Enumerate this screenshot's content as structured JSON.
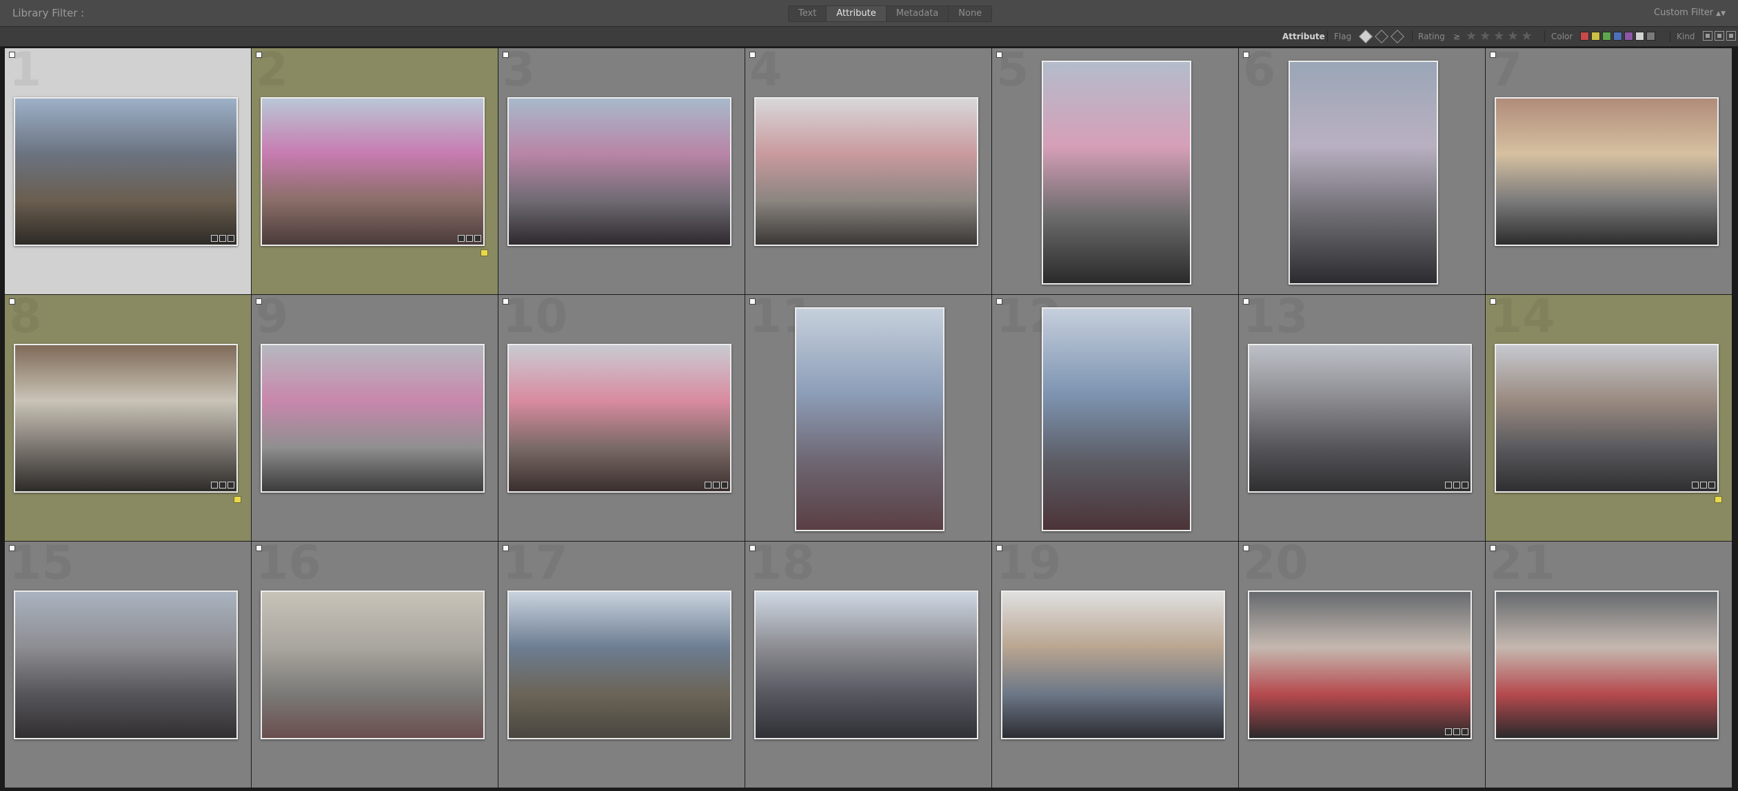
{
  "filter_bar": {
    "title": "Library Filter :",
    "tabs": [
      "Text",
      "Attribute",
      "Metadata",
      "None"
    ],
    "active_tab": "Attribute",
    "custom_filter": "Custom Filter"
  },
  "attribute_bar": {
    "attribute_label": "Attribute",
    "flag_label": "Flag",
    "rating_label": "Rating",
    "rating_operator": "≥",
    "stars": "★★★★★",
    "color_label": "Color",
    "colors": [
      "#c94a4a",
      "#cbbf45",
      "#5ea64d",
      "#4d71b8",
      "#8c57a7",
      "#d2d2d2",
      "#7a7a7a"
    ],
    "kind_label": "Kind"
  },
  "grid": {
    "cells": [
      {
        "num": "1",
        "orient": "land",
        "state": "selected",
        "badges": true,
        "tag": false,
        "colors": [
          "#9db1c8",
          "#6b7380",
          "#6a5e4f",
          "#2d2a26"
        ]
      },
      {
        "num": "2",
        "orient": "land",
        "state": "tinted",
        "badges": true,
        "tag": true,
        "colors": [
          "#b9c7d6",
          "#c77bb0",
          "#8a6e68",
          "#4a3b3a"
        ]
      },
      {
        "num": "3",
        "orient": "land",
        "state": "normal",
        "badges": false,
        "tag": false,
        "colors": [
          "#a8b9cc",
          "#b885a6",
          "#6f6a73",
          "#2e2a2e"
        ]
      },
      {
        "num": "4",
        "orient": "land",
        "state": "normal",
        "badges": false,
        "tag": false,
        "colors": [
          "#d8d8da",
          "#c99a9e",
          "#8b8580",
          "#3a3836"
        ]
      },
      {
        "num": "5",
        "orient": "port",
        "state": "normal",
        "badges": false,
        "tag": false,
        "colors": [
          "#b3bccb",
          "#d69fb8",
          "#6b6b6b",
          "#2b2b2b"
        ]
      },
      {
        "num": "6",
        "orient": "port",
        "state": "normal",
        "badges": false,
        "tag": false,
        "colors": [
          "#9aa6b6",
          "#b9b0c2",
          "#6c6b70",
          "#2c2c30"
        ]
      },
      {
        "num": "7",
        "orient": "land",
        "state": "normal",
        "badges": false,
        "tag": false,
        "colors": [
          "#b08c7a",
          "#d6c0a0",
          "#7b7b7b",
          "#2d2d2d"
        ]
      },
      {
        "num": "8",
        "orient": "land",
        "state": "tinted",
        "badges": true,
        "tag": true,
        "colors": [
          "#7f6a58",
          "#c9c4b7",
          "#7b7570",
          "#2d2b28"
        ]
      },
      {
        "num": "9",
        "orient": "land",
        "state": "normal",
        "badges": false,
        "tag": false,
        "colors": [
          "#b6b8bf",
          "#c887ac",
          "#8f8f8f",
          "#3b3b3b"
        ]
      },
      {
        "num": "10",
        "orient": "land",
        "state": "normal",
        "badges": true,
        "tag": false,
        "colors": [
          "#c9cbd2",
          "#d98ba0",
          "#7a6a66",
          "#3a2f2e"
        ]
      },
      {
        "num": "11",
        "orient": "port",
        "state": "normal",
        "badges": false,
        "tag": false,
        "colors": [
          "#c6d0dc",
          "#8d9eb8",
          "#6d6570",
          "#5a3f44"
        ]
      },
      {
        "num": "12",
        "orient": "port",
        "state": "normal",
        "badges": false,
        "tag": false,
        "colors": [
          "#c6cfdc",
          "#7e95b2",
          "#5b5b63",
          "#4b3438"
        ]
      },
      {
        "num": "13",
        "orient": "land",
        "state": "normal",
        "badges": true,
        "tag": false,
        "colors": [
          "#bdc1c8",
          "#8a8a8e",
          "#56565a",
          "#2f2f31"
        ]
      },
      {
        "num": "14",
        "orient": "land",
        "state": "tinted",
        "badges": true,
        "tag": true,
        "colors": [
          "#c6c9cf",
          "#9a8a80",
          "#5a5a5e",
          "#2f2f31"
        ]
      },
      {
        "num": "15",
        "orient": "land",
        "state": "normal",
        "badges": false,
        "tag": false,
        "colors": [
          "#a9b3bf",
          "#8d8d92",
          "#56565a",
          "#322f31"
        ]
      },
      {
        "num": "16",
        "orient": "land",
        "state": "normal",
        "badges": false,
        "tag": false,
        "colors": [
          "#c8c3b8",
          "#a9a59f",
          "#7b7a77",
          "#6a4e4e"
        ]
      },
      {
        "num": "17",
        "orient": "land",
        "state": "normal",
        "badges": false,
        "tag": false,
        "colors": [
          "#c9d3de",
          "#6d7d92",
          "#6b6457",
          "#4a4740"
        ]
      },
      {
        "num": "18",
        "orient": "land",
        "state": "normal",
        "badges": false,
        "tag": false,
        "colors": [
          "#cfd8e4",
          "#8c8c92",
          "#575760",
          "#303036"
        ]
      },
      {
        "num": "19",
        "orient": "land",
        "state": "normal",
        "badges": false,
        "tag": false,
        "colors": [
          "#e0e0e0",
          "#b9a590",
          "#6c7787",
          "#2d2d33"
        ]
      },
      {
        "num": "20",
        "orient": "land",
        "state": "normal",
        "badges": true,
        "tag": false,
        "colors": [
          "#666a6e",
          "#c5b8b0",
          "#b54a4e",
          "#2a2a2c"
        ]
      },
      {
        "num": "21",
        "orient": "land",
        "state": "normal",
        "badges": false,
        "tag": false,
        "colors": [
          "#666a6e",
          "#c5b8b0",
          "#b54a4e",
          "#2a2a2c"
        ]
      }
    ]
  }
}
